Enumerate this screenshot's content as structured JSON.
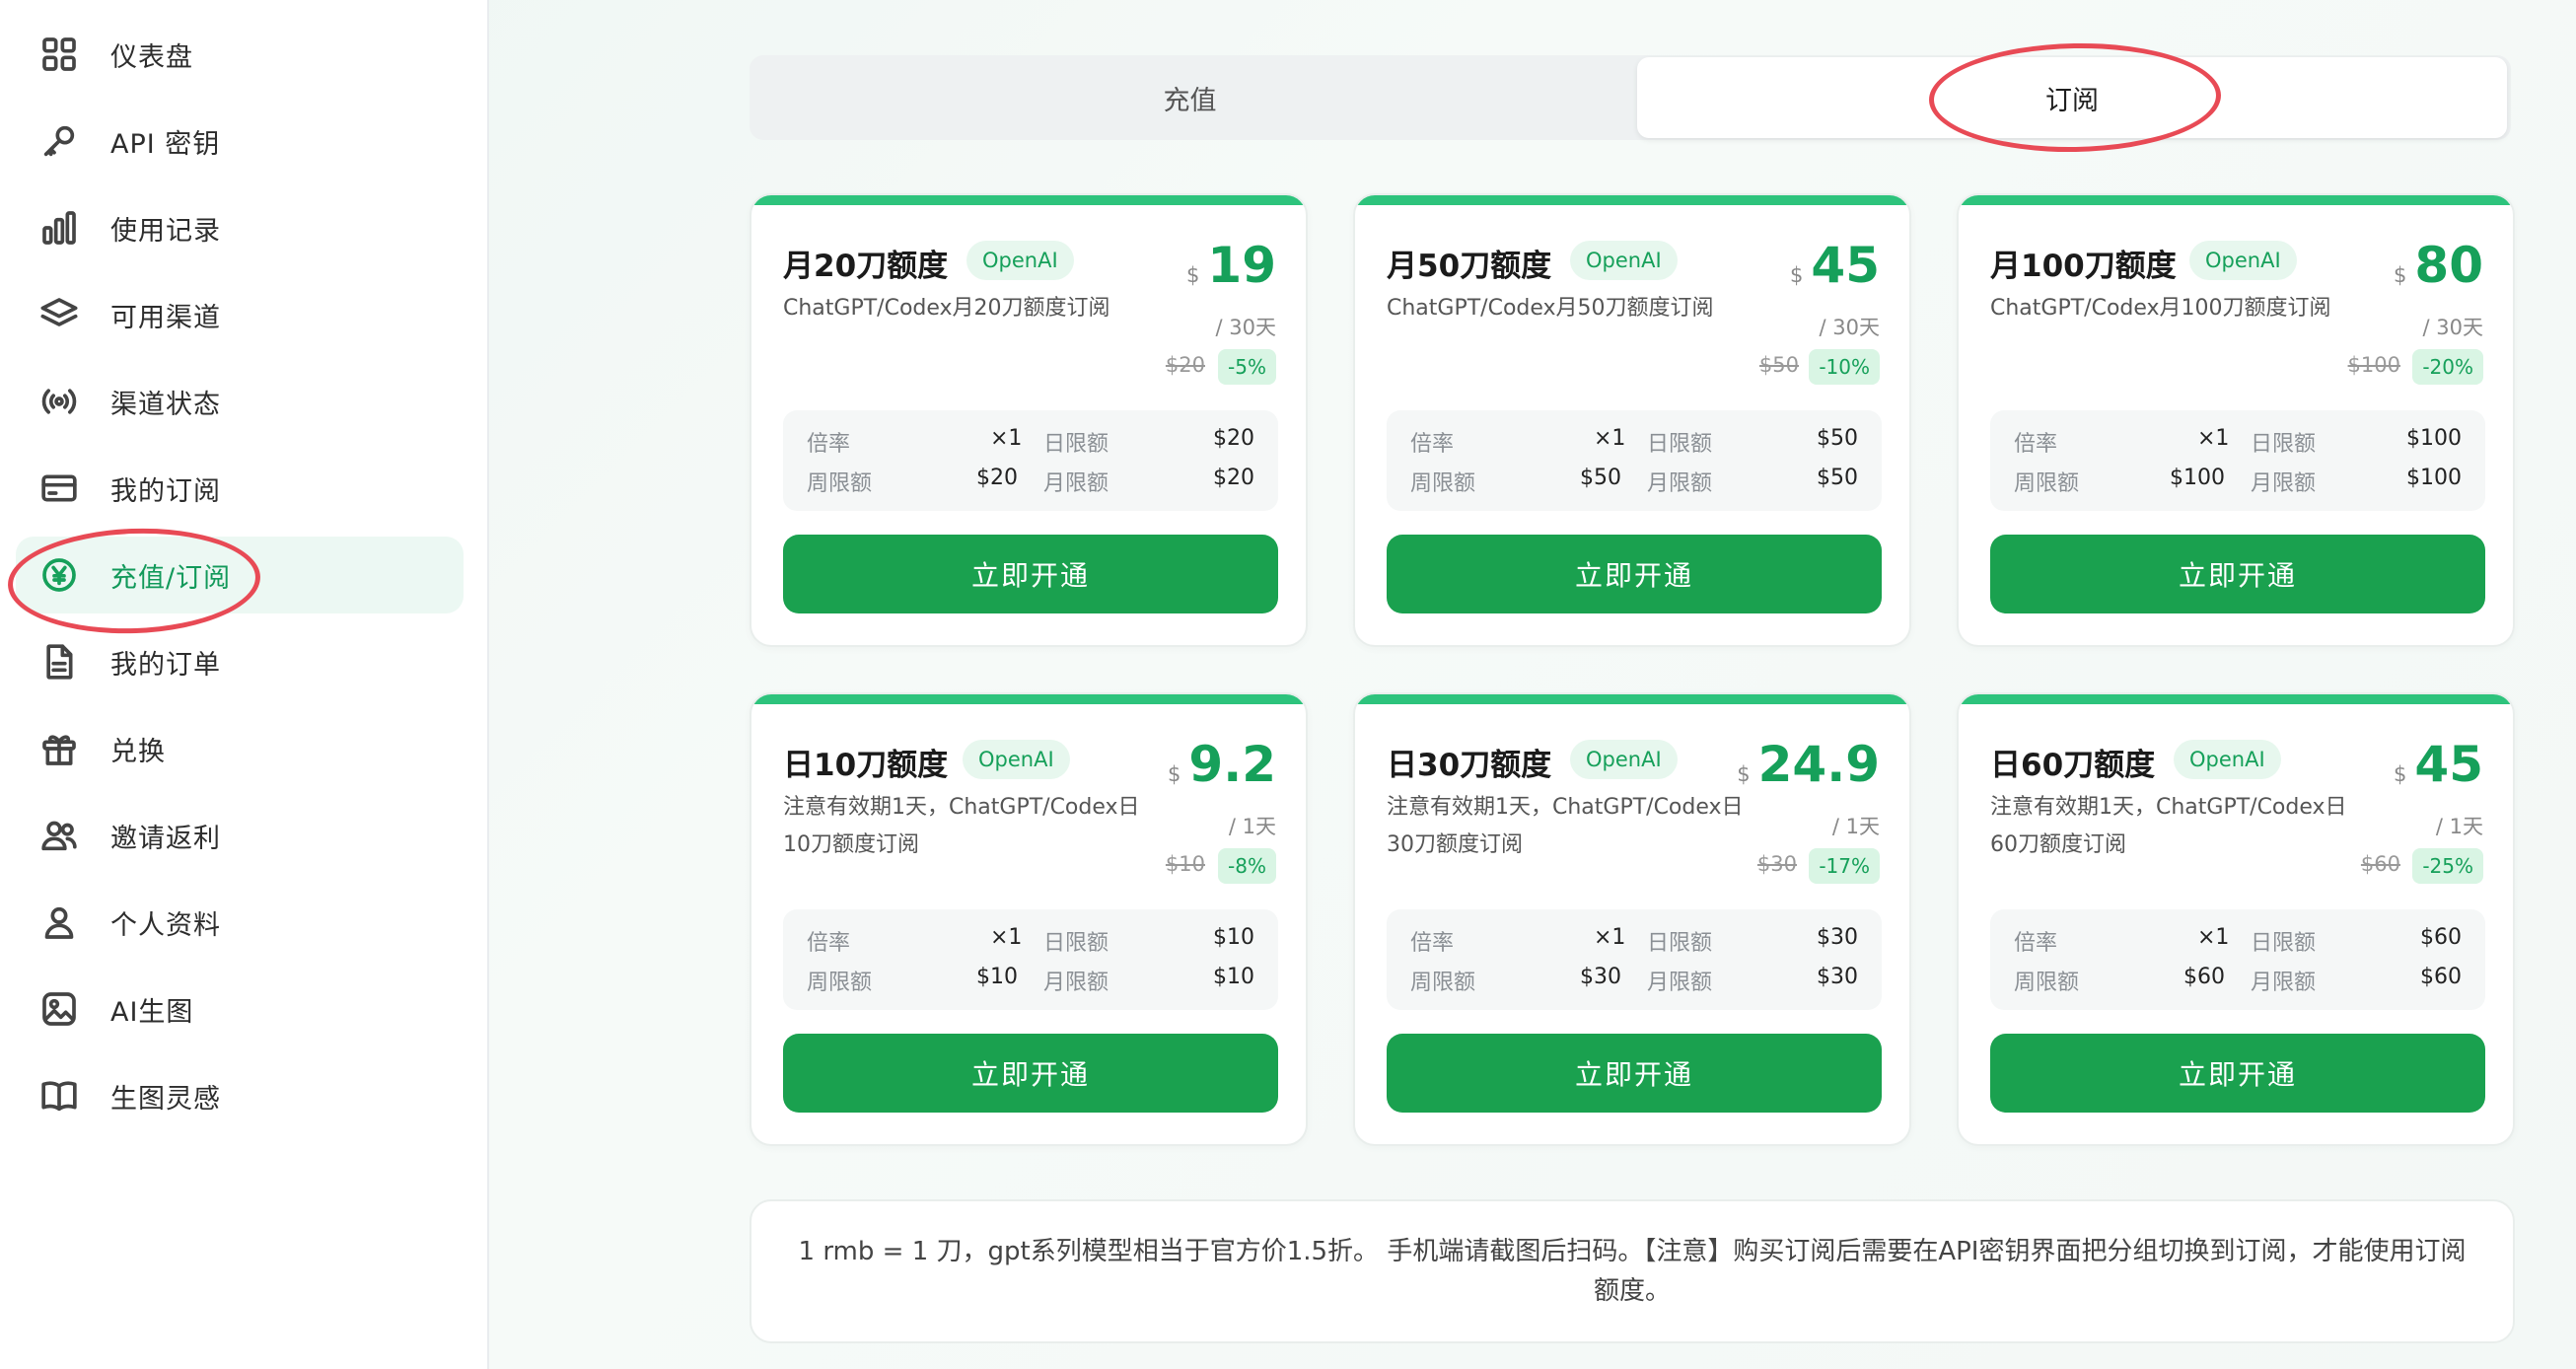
{
  "sidebar": {
    "items": [
      {
        "label": "仪表盘",
        "icon": "dashboard-icon"
      },
      {
        "label": "API 密钥",
        "icon": "key-icon"
      },
      {
        "label": "使用记录",
        "icon": "bar-chart-icon"
      },
      {
        "label": "可用渠道",
        "icon": "layers-icon"
      },
      {
        "label": "渠道状态",
        "icon": "signal-icon"
      },
      {
        "label": "我的订阅",
        "icon": "credit-card-icon"
      },
      {
        "label": "充值/订阅",
        "icon": "yen-icon",
        "active": true
      },
      {
        "label": "我的订单",
        "icon": "document-icon"
      },
      {
        "label": "兑换",
        "icon": "gift-icon"
      },
      {
        "label": "邀请返利",
        "icon": "users-icon"
      },
      {
        "label": "个人资料",
        "icon": "user-icon"
      },
      {
        "label": "AI生图",
        "icon": "image-icon"
      },
      {
        "label": "生图灵感",
        "icon": "book-icon"
      }
    ]
  },
  "tabs": [
    {
      "label": "充值",
      "active": false
    },
    {
      "label": "订阅",
      "active": true
    }
  ],
  "plans": [
    {
      "title": "月20刀额度",
      "badge": "OpenAI",
      "desc": "ChatGPT/Codex月20刀额度订阅",
      "currency": "$",
      "price": "19",
      "period": "/ 30天",
      "original": "$20",
      "discount": "-5%",
      "stats": {
        "rate_label": "倍率",
        "rate": "×1",
        "daily_label": "日限额",
        "daily": "$20",
        "weekly_label": "周限额",
        "weekly": "$20",
        "monthly_label": "月限额",
        "monthly": "$20"
      },
      "cta": "立即开通"
    },
    {
      "title": "月50刀额度",
      "badge": "OpenAI",
      "desc": "ChatGPT/Codex月50刀额度订阅",
      "currency": "$",
      "price": "45",
      "period": "/ 30天",
      "original": "$50",
      "discount": "-10%",
      "stats": {
        "rate_label": "倍率",
        "rate": "×1",
        "daily_label": "日限额",
        "daily": "$50",
        "weekly_label": "周限额",
        "weekly": "$50",
        "monthly_label": "月限额",
        "monthly": "$50"
      },
      "cta": "立即开通"
    },
    {
      "title": "月100刀额度",
      "badge": "OpenAI",
      "desc": "ChatGPT/Codex月100刀额度订阅",
      "currency": "$",
      "price": "80",
      "period": "/ 30天",
      "original": "$100",
      "discount": "-20%",
      "stats": {
        "rate_label": "倍率",
        "rate": "×1",
        "daily_label": "日限额",
        "daily": "$100",
        "weekly_label": "周限额",
        "weekly": "$100",
        "monthly_label": "月限额",
        "monthly": "$100"
      },
      "cta": "立即开通"
    },
    {
      "title": "日10刀额度",
      "badge": "OpenAI",
      "desc": "注意有效期1天，ChatGPT/Codex日10刀额度订阅",
      "currency": "$",
      "price": "9.2",
      "period": "/ 1天",
      "original": "$10",
      "discount": "-8%",
      "stats": {
        "rate_label": "倍率",
        "rate": "×1",
        "daily_label": "日限额",
        "daily": "$10",
        "weekly_label": "周限额",
        "weekly": "$10",
        "monthly_label": "月限额",
        "monthly": "$10"
      },
      "cta": "立即开通"
    },
    {
      "title": "日30刀额度",
      "badge": "OpenAI",
      "desc": "注意有效期1天，ChatGPT/Codex日30刀额度订阅",
      "currency": "$",
      "price": "24.9",
      "period": "/ 1天",
      "original": "$30",
      "discount": "-17%",
      "stats": {
        "rate_label": "倍率",
        "rate": "×1",
        "daily_label": "日限额",
        "daily": "$30",
        "weekly_label": "周限额",
        "weekly": "$30",
        "monthly_label": "月限额",
        "monthly": "$30"
      },
      "cta": "立即开通"
    },
    {
      "title": "日60刀额度",
      "badge": "OpenAI",
      "desc": "注意有效期1天，ChatGPT/Codex日60刀额度订阅",
      "currency": "$",
      "price": "45",
      "period": "/ 1天",
      "original": "$60",
      "discount": "-25%",
      "stats": {
        "rate_label": "倍率",
        "rate": "×1",
        "daily_label": "日限额",
        "daily": "$60",
        "weekly_label": "周限额",
        "weekly": "$60",
        "monthly_label": "月限额",
        "monthly": "$60"
      },
      "cta": "立即开通"
    }
  ],
  "note": "1 rmb = 1 刀，gpt系列模型相当于官方价1.5折。 手机端请截图后扫码。【注意】购买订阅后需要在API密钥界面把分组切换到订阅，才能使用订阅额度。",
  "colors": {
    "accent": "#16a05a",
    "button": "#1aa14f",
    "highlight_circle": "#e84a55"
  }
}
